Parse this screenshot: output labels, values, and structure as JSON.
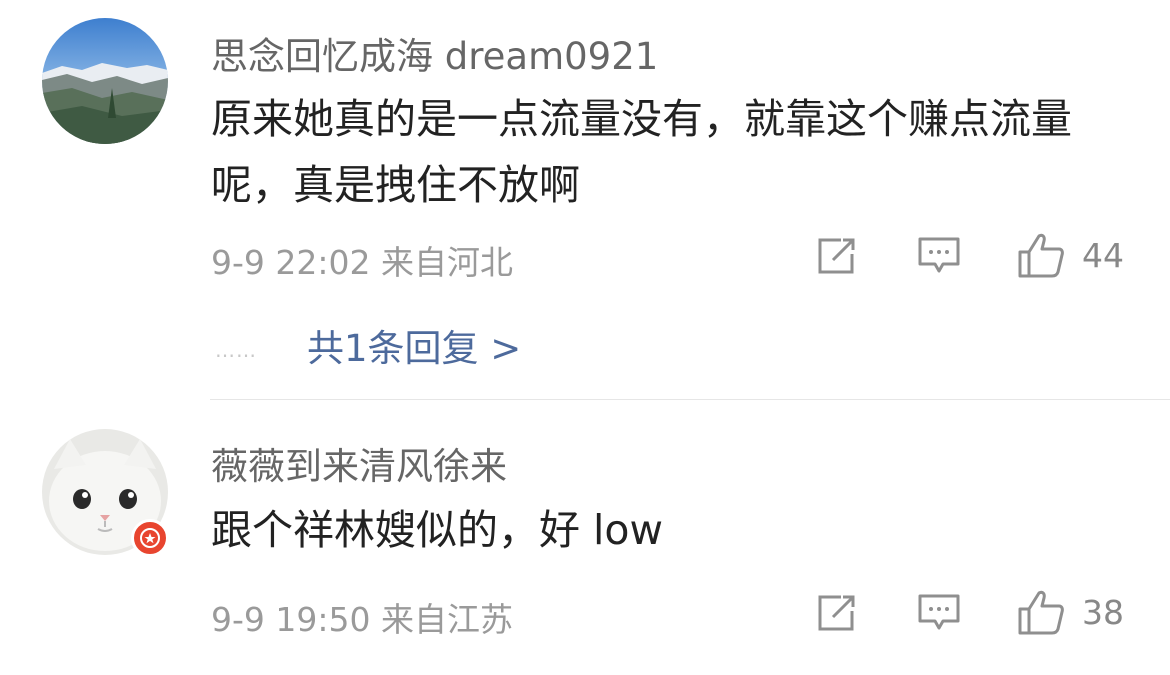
{
  "comments": [
    {
      "username": "思念回忆成海 dream0921",
      "text": "原来她真的是一点流量没有，就靠这个赚点流量呢，真是拽住不放啊",
      "time": "9-9 22:02",
      "location": "来自河北",
      "likes": "44",
      "icons": [
        "share-icon",
        "comment-icon",
        "like-icon"
      ]
    },
    {
      "username": "薇薇到来清风徐来",
      "text": "跟个祥林嫂似的，好 low",
      "time": "9-9 19:50",
      "location": "来自江苏",
      "likes": "38",
      "icons": [
        "share-icon",
        "comment-icon",
        "like-icon"
      ]
    }
  ],
  "replies_link": {
    "dots": "……",
    "label": "共1条回复 >"
  },
  "colors": {
    "link": "#4d6a9c",
    "badge": "#e8452f",
    "meta": "#9a9a9a"
  }
}
